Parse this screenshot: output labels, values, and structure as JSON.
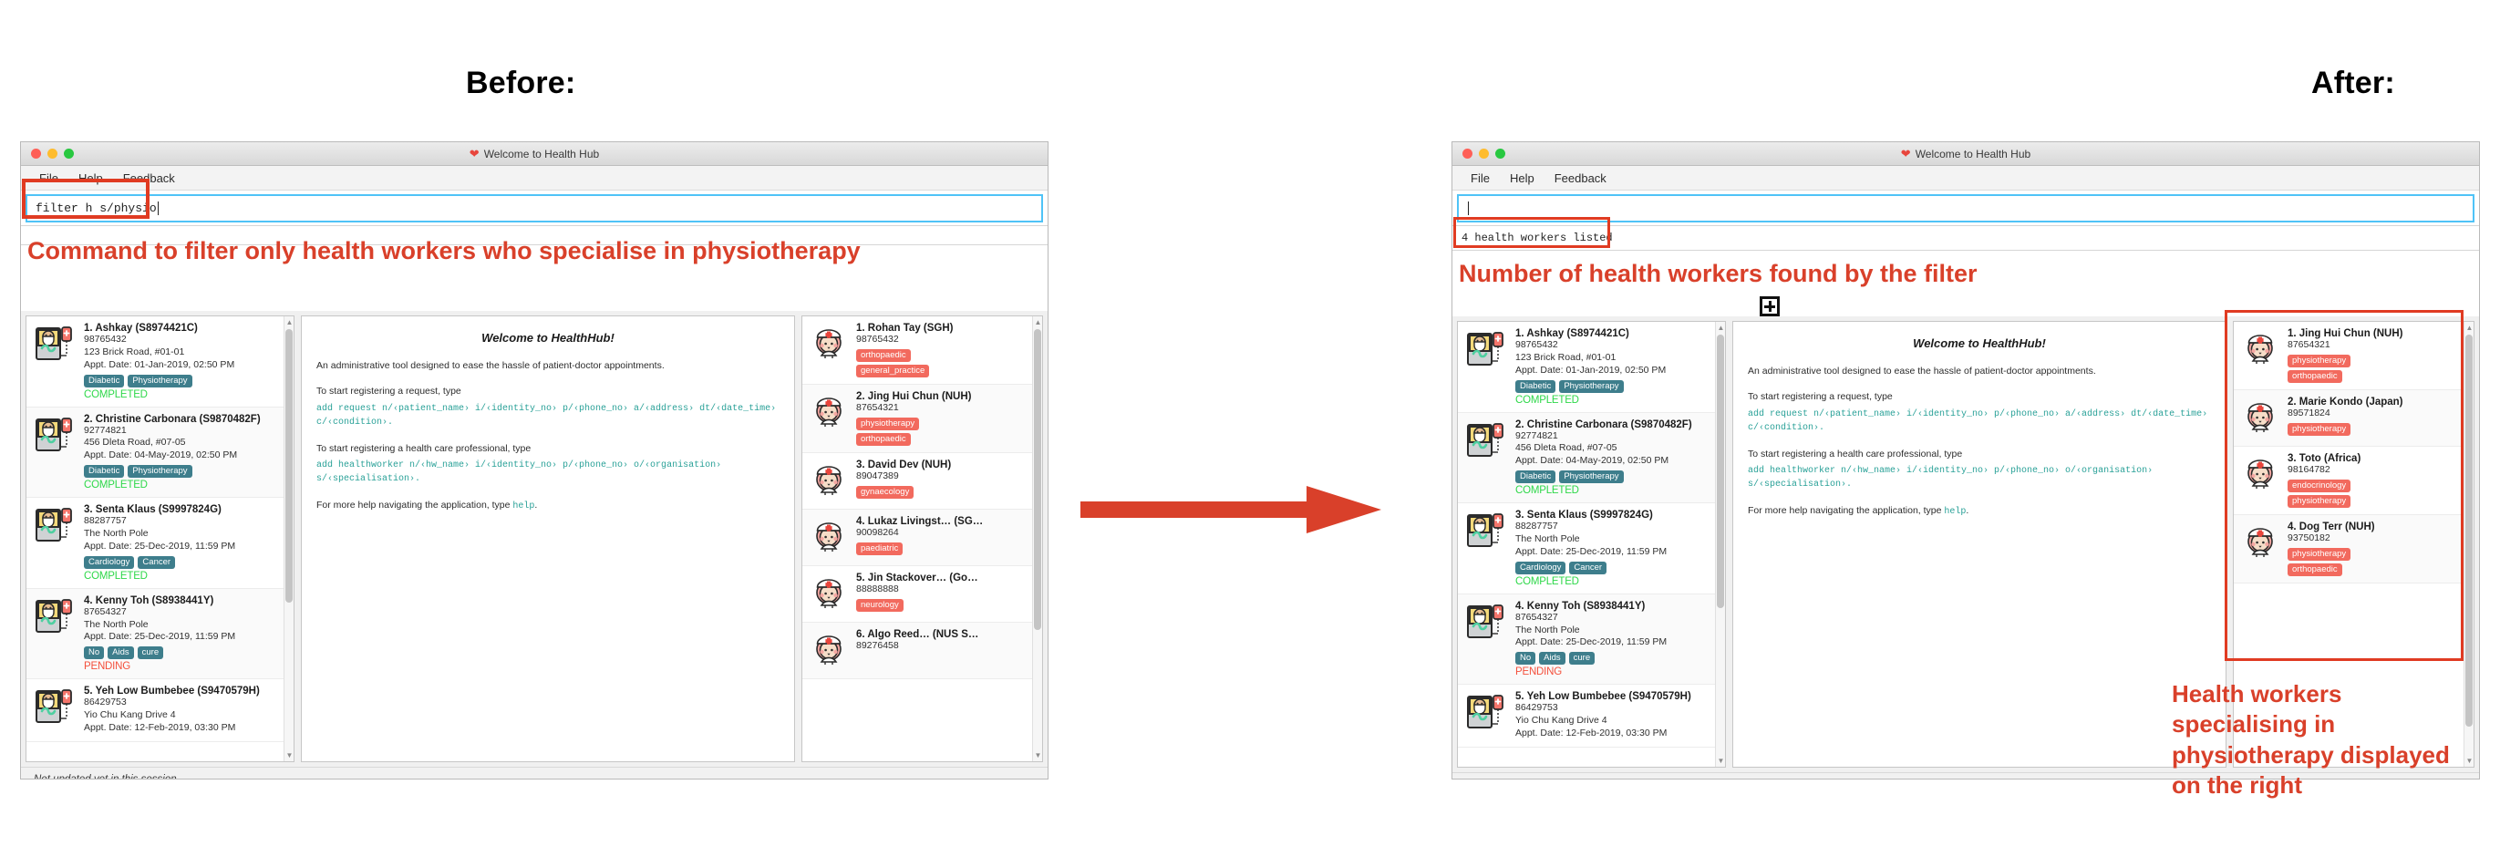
{
  "labels": {
    "before": "Before:",
    "after": "After:"
  },
  "window": {
    "title": "Welcome to Health Hub",
    "heart_icon": "heart-icon",
    "menu": [
      "File",
      "Help",
      "Feedback"
    ],
    "statusbar": "Not updated yet in this session"
  },
  "before": {
    "command_value": "filter h s/physio",
    "result_text": "",
    "annotation": "Command to filter only health workers who specialise in physiotherapy"
  },
  "after": {
    "command_value": "",
    "command_placeholder": "",
    "result_text": "4 health workers listed",
    "annotation_top": "Number of health workers found by the filter",
    "annotation_bottom": "Health workers specialising in physiotherapy displayed on the right"
  },
  "welcome": {
    "title": "Welcome to HealthHub!",
    "intro": "An administrative tool designed to ease the hassle of patient-doctor appointments.",
    "request_lead": "To start registering a request, type",
    "request_code": "add request n/‹patient_name› i/‹identity_no› p/‹phone_no› a/‹address› dt/‹date_time› c/‹condition›.",
    "worker_lead": "To start registering a health care professional, type",
    "worker_code": "add healthworker n/‹hw_name› i/‹identity_no› p/‹phone_no› o/‹organisation› s/‹specialisation›.",
    "help_lead": "For more help navigating the application, type ",
    "help_code": "help",
    "help_tail": "."
  },
  "patients": [
    {
      "index": "1.",
      "name": "Ashkay (S8974421C)",
      "phone": "98765432",
      "address": "123 Brick Road, #01-01",
      "appt": "Appt. Date: 01-Jan-2019, 02:50 PM",
      "tags": [
        "Diabetic",
        "Physiotherapy"
      ],
      "status": "COMPLETED",
      "status_kind": "completed"
    },
    {
      "index": "2.",
      "name": "Christine Carbonara (S9870482F)",
      "phone": "92774821",
      "address": "456 Dleta Road, #07-05",
      "appt": "Appt. Date: 04-May-2019, 02:50 PM",
      "tags": [
        "Diabetic",
        "Physiotherapy"
      ],
      "status": "COMPLETED",
      "status_kind": "completed"
    },
    {
      "index": "3.",
      "name": "Senta Klaus (S9997824G)",
      "phone": "88287757",
      "address": "The North Pole",
      "appt": "Appt. Date: 25-Dec-2019, 11:59 PM",
      "tags": [
        "Cardiology",
        "Cancer"
      ],
      "status": "COMPLETED",
      "status_kind": "completed"
    },
    {
      "index": "4.",
      "name": "Kenny Toh (S8938441Y)",
      "phone": "87654327",
      "address": "The North Pole",
      "appt": "Appt. Date: 25-Dec-2019, 11:59 PM",
      "tags": [
        "No",
        "Aids",
        "cure"
      ],
      "status": "PENDING",
      "status_kind": "pending"
    },
    {
      "index": "5.",
      "name": "Yeh Low Bumbebee (S9470579H)",
      "phone": "86429753",
      "address": "Yio Chu Kang Drive 4",
      "appt": "Appt. Date: 12-Feb-2019, 03:30 PM",
      "tags": [],
      "status": "",
      "status_kind": "completed"
    }
  ],
  "workers_before": [
    {
      "index": "1.",
      "name": "Rohan Tay",
      "org": "(SGH)",
      "phone": "98765432",
      "tags": [
        "orthopaedic",
        "general_practice"
      ]
    },
    {
      "index": "2.",
      "name": "Jing Hui Chun",
      "org": "(NUH)",
      "phone": "87654321",
      "tags": [
        "physiotherapy",
        "orthopaedic"
      ]
    },
    {
      "index": "3.",
      "name": "David Dev",
      "org": "(NUH)",
      "phone": "89047389",
      "tags": [
        "gynaecology"
      ]
    },
    {
      "index": "4.",
      "name": "Lukaz Livingst…",
      "org": "(SG…",
      "phone": "90098264",
      "tags": [
        "paediatric"
      ]
    },
    {
      "index": "5.",
      "name": "Jin Stackover…",
      "org": "(Go…",
      "phone": "88888888",
      "tags": [
        "neurology"
      ]
    },
    {
      "index": "6.",
      "name": "Algo Reed…",
      "org": "(NUS S…",
      "phone": "89276458",
      "tags": []
    }
  ],
  "workers_after": [
    {
      "index": "1.",
      "name": "Jing Hui Chun",
      "org": "(NUH)",
      "phone": "87654321",
      "tags": [
        "physiotherapy",
        "orthopaedic"
      ]
    },
    {
      "index": "2.",
      "name": "Marie Kondo",
      "org": "(Japan)",
      "phone": "89571824",
      "tags": [
        "physiotherapy"
      ]
    },
    {
      "index": "3.",
      "name": "Toto",
      "org": "(Africa)",
      "phone": "98164782",
      "tags": [
        "endocrinology",
        "physiotherapy"
      ]
    },
    {
      "index": "4.",
      "name": "Dog Terr",
      "org": "(NUH)",
      "phone": "93750182",
      "tags": [
        "physiotherapy",
        "orthopaedic"
      ]
    }
  ],
  "colors": {
    "annotation_red": "#d9402a",
    "highlight_box": "#e03b22",
    "command_border": "#4fc3f7",
    "tag_condition": "#3e7e8c",
    "tag_specialisation": "#f26a5e",
    "status_completed": "#2fd84a",
    "status_pending": "#f4503c",
    "code_teal": "#2aa198"
  }
}
